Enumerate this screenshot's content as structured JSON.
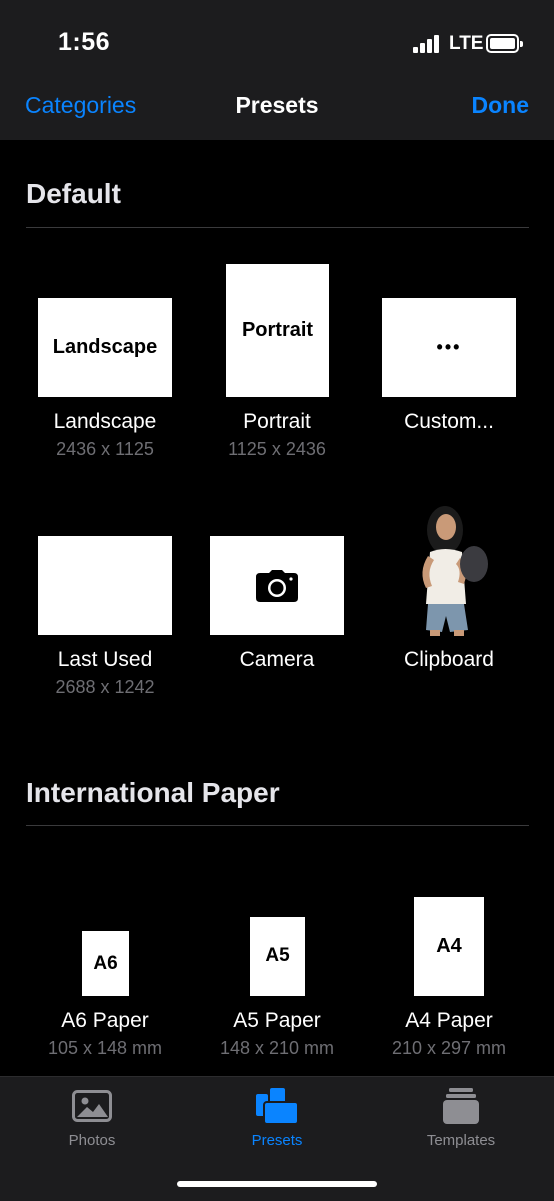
{
  "status": {
    "time": "1:56",
    "network": "LTE"
  },
  "nav": {
    "left": "Categories",
    "title": "Presets",
    "right": "Done"
  },
  "sections": {
    "default_title": "Default",
    "paper_title": "International Paper"
  },
  "default_items": {
    "landscape": {
      "thumb": "Landscape",
      "label": "Landscape",
      "size": "2436 x 1125"
    },
    "portrait": {
      "thumb": "Portrait",
      "label": "Portrait",
      "size": "1125 x 2436"
    },
    "custom": {
      "thumb": "•••",
      "label": "Custom..."
    },
    "last_used": {
      "label": "Last Used",
      "size": "2688 x 1242"
    },
    "camera": {
      "icon": "camera-icon",
      "label": "Camera"
    },
    "clipboard": {
      "image": "person-photo",
      "label": "Clipboard"
    }
  },
  "paper_items": {
    "a6": {
      "thumb": "A6",
      "label": "A6 Paper",
      "size": "105 x 148 mm"
    },
    "a5": {
      "thumb": "A5",
      "label": "A5 Paper",
      "size": "148 x 210 mm"
    },
    "a4": {
      "thumb": "A4",
      "label": "A4 Paper",
      "size": "210 x 297 mm"
    }
  },
  "tabs": {
    "photos": {
      "label": "Photos",
      "icon": "photo-icon"
    },
    "presets": {
      "label": "Presets",
      "icon": "presets-icon",
      "active": true
    },
    "templates": {
      "label": "Templates",
      "icon": "templates-icon"
    }
  },
  "colors": {
    "accent": "#0a84ff",
    "background": "#000000",
    "bar": "#1c1c1e",
    "secondary_text": "#6e6e73"
  }
}
